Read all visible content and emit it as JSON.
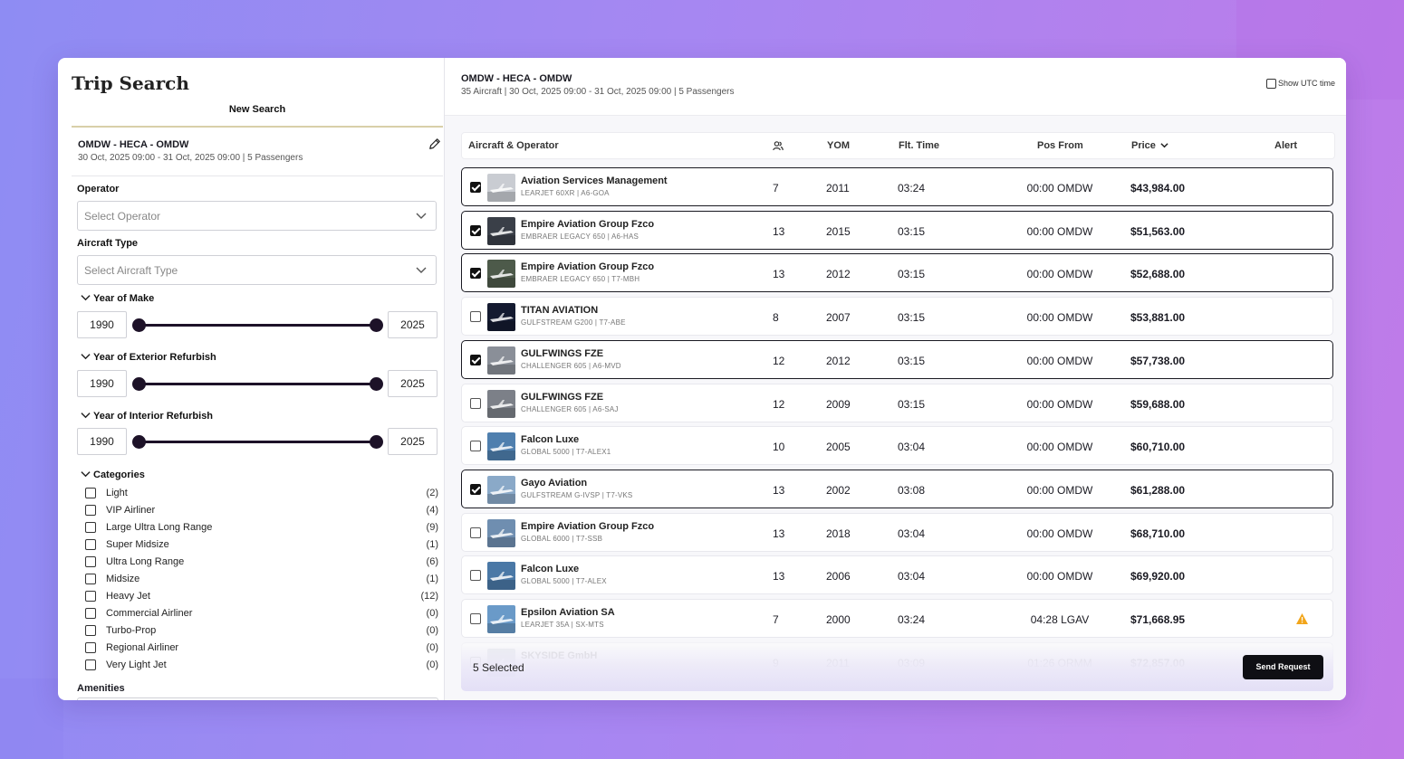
{
  "left": {
    "title": "Trip Search",
    "new_search": "New Search",
    "route": "OMDW - HECA - OMDW",
    "route_details": "30 Oct, 2025 09:00 - 31 Oct, 2025 09:00 | 5 Passengers",
    "operator_label": "Operator",
    "operator_placeholder": "Select Operator",
    "aircraft_type_label": "Aircraft Type",
    "aircraft_type_placeholder": "Select Aircraft Type",
    "ranges": [
      {
        "label": "Year of Make",
        "min": "1990",
        "max": "2025"
      },
      {
        "label": "Year of Exterior Refurbish",
        "min": "1990",
        "max": "2025"
      },
      {
        "label": "Year of Interior Refurbish",
        "min": "1990",
        "max": "2025"
      }
    ],
    "categories_label": "Categories",
    "categories": [
      {
        "label": "Light",
        "count": "(2)"
      },
      {
        "label": "VIP Airliner",
        "count": "(4)"
      },
      {
        "label": "Large Ultra Long Range",
        "count": "(9)"
      },
      {
        "label": "Super Midsize",
        "count": "(1)"
      },
      {
        "label": "Ultra Long Range",
        "count": "(6)"
      },
      {
        "label": "Midsize",
        "count": "(1)"
      },
      {
        "label": "Heavy Jet",
        "count": "(12)"
      },
      {
        "label": "Commercial Airliner",
        "count": "(0)"
      },
      {
        "label": "Turbo-Prop",
        "count": "(0)"
      },
      {
        "label": "Regional Airliner",
        "count": "(0)"
      },
      {
        "label": "Very Light Jet",
        "count": "(0)"
      }
    ],
    "amenities_label": "Amenities"
  },
  "right": {
    "route": "OMDW - HECA - OMDW",
    "summary": "35 Aircraft | 30 Oct, 2025 09:00 - 31 Oct, 2025 09:00 | 5 Passengers",
    "utc_label": "Show UTC time",
    "columns": {
      "aircraft": "Aircraft & Operator",
      "yom": "YOM",
      "flt_time": "Flt. Time",
      "pos_from": "Pos From",
      "price": "Price",
      "alert": "Alert"
    },
    "rows": [
      {
        "operator": "Aviation Services Management",
        "aircraft": "LEARJET 60XR | A6-GOA",
        "pax": "7",
        "yom": "2011",
        "flt": "03:24",
        "pos": "00:00 OMDW",
        "price": "$43,984.00",
        "selected": true,
        "alert": false,
        "tone": "#c9ccd2"
      },
      {
        "operator": "Empire Aviation Group Fzco",
        "aircraft": "EMBRAER LEGACY 650 | A6-HAS",
        "pax": "13",
        "yom": "2015",
        "flt": "03:15",
        "pos": "00:00 OMDW",
        "price": "$51,563.00",
        "selected": true,
        "alert": false,
        "tone": "#3a3f48"
      },
      {
        "operator": "Empire Aviation Group Fzco",
        "aircraft": "EMBRAER LEGACY 650 | T7-MBH",
        "pax": "13",
        "yom": "2012",
        "flt": "03:15",
        "pos": "00:00 OMDW",
        "price": "$52,688.00",
        "selected": true,
        "alert": false,
        "tone": "#4d5a4a"
      },
      {
        "operator": "TITAN AVIATION",
        "aircraft": "GULFSTREAM G200 | T7-ABE",
        "pax": "8",
        "yom": "2007",
        "flt": "03:15",
        "pos": "00:00 OMDW",
        "price": "$53,881.00",
        "selected": false,
        "alert": false,
        "tone": "#141a30"
      },
      {
        "operator": "GULFWINGS FZE",
        "aircraft": "CHALLENGER 605 | A6-MVD",
        "pax": "12",
        "yom": "2012",
        "flt": "03:15",
        "pos": "00:00 OMDW",
        "price": "$57,738.00",
        "selected": true,
        "alert": false,
        "tone": "#8a8f98"
      },
      {
        "operator": "GULFWINGS FZE",
        "aircraft": "CHALLENGER 605 | A6-SAJ",
        "pax": "12",
        "yom": "2009",
        "flt": "03:15",
        "pos": "00:00 OMDW",
        "price": "$59,688.00",
        "selected": false,
        "alert": false,
        "tone": "#7c8088"
      },
      {
        "operator": "Falcon Luxe",
        "aircraft": "GLOBAL 5000 | T7-ALEX1",
        "pax": "10",
        "yom": "2005",
        "flt": "03:04",
        "pos": "00:00 OMDW",
        "price": "$60,710.00",
        "selected": false,
        "alert": false,
        "tone": "#4f7fae"
      },
      {
        "operator": "Gayo Aviation",
        "aircraft": "GULFSTREAM G-IVSP | T7-VKS",
        "pax": "13",
        "yom": "2002",
        "flt": "03:08",
        "pos": "00:00 OMDW",
        "price": "$61,288.00",
        "selected": true,
        "alert": false,
        "tone": "#8aa9c8"
      },
      {
        "operator": "Empire Aviation Group Fzco",
        "aircraft": "GLOBAL 6000 | T7-SSB",
        "pax": "13",
        "yom": "2018",
        "flt": "03:04",
        "pos": "00:00 OMDW",
        "price": "$68,710.00",
        "selected": false,
        "alert": false,
        "tone": "#6f8eb0"
      },
      {
        "operator": "Falcon Luxe",
        "aircraft": "GLOBAL 5000 | T7-ALEX",
        "pax": "13",
        "yom": "2006",
        "flt": "03:04",
        "pos": "00:00 OMDW",
        "price": "$69,920.00",
        "selected": false,
        "alert": false,
        "tone": "#4a78a6"
      },
      {
        "operator": "Epsilon Aviation SA",
        "aircraft": "LEARJET 35A | SX-MTS",
        "pax": "7",
        "yom": "2000",
        "flt": "03:24",
        "pos": "04:28 LGAV",
        "price": "$71,668.95",
        "selected": false,
        "alert": true,
        "tone": "#6a9ac8"
      },
      {
        "operator": "SKYSIDE GmbH",
        "aircraft": "",
        "pax": "9",
        "yom": "2011",
        "flt": "03:09",
        "pos": "01:26 ORMM",
        "price": "$72,857.00",
        "selected": false,
        "alert": false,
        "tone": "#9aa6b8"
      }
    ],
    "selected_count": "5 Selected",
    "send_button": "Send Request"
  },
  "colors": {
    "accent": "#1d1228",
    "alert": "#f2a51a"
  }
}
